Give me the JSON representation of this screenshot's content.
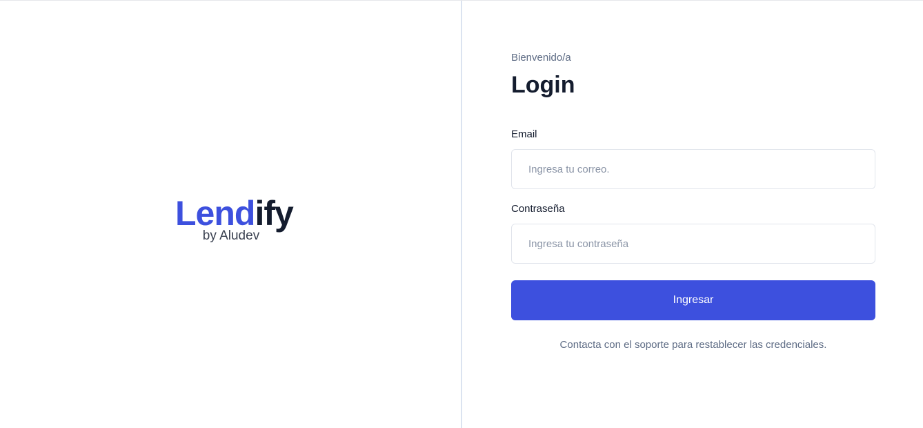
{
  "brand": {
    "name_part1": "Lend",
    "name_part2": "ify",
    "subtitle": "by Aludev",
    "accent_color": "#3d50de",
    "dark_color": "#141c2e"
  },
  "login": {
    "welcome": "Bienvenido/a",
    "title": "Login",
    "email_label": "Email",
    "email_placeholder": "Ingresa tu correo.",
    "email_value": "",
    "password_label": "Contraseña",
    "password_placeholder": "Ingresa tu contraseña",
    "password_value": "",
    "submit_label": "Ingresar",
    "help_text": "Contacta con el soporte para restablecer las credenciales."
  }
}
